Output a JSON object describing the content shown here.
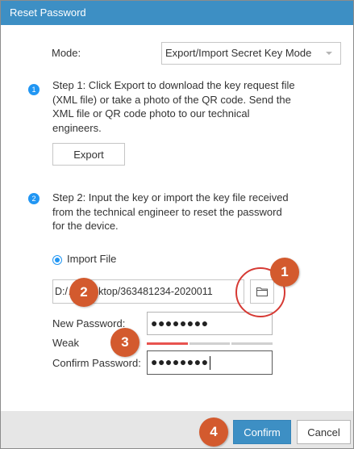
{
  "dialog": {
    "title": "Reset Password"
  },
  "mode": {
    "label": "Mode:",
    "selected": "Export/Import Secret Key Mode"
  },
  "step1": {
    "number": "1",
    "lines": [
      "Step 1: Click Export to download the key request file",
      "(XML file) or take a photo of the QR code. Send the",
      "XML file or QR code photo to our technical",
      "engineers."
    ],
    "export_label": "Export"
  },
  "step2": {
    "number": "2",
    "lines": [
      "Step 2: Input the key or import the key file received",
      "from the technical engineer to reset the password",
      "for the device."
    ],
    "import_option": "Import File",
    "file_path": "D:/…/Desktop/363481234-2020011"
  },
  "new_password": {
    "label": "New Password:",
    "masked_value": "●●●●●●●●"
  },
  "strength": {
    "label": "Weak",
    "level": 1,
    "levels_total": 3,
    "active_color": "#e8534f",
    "inactive_color": "#d0d0d0"
  },
  "confirm_password": {
    "label": "Confirm Password:",
    "masked_value": "●●●●●●●●"
  },
  "footer": {
    "confirm_label": "Confirm",
    "cancel_label": "Cancel"
  },
  "annotations": {
    "badge1": "1",
    "badge2": "2",
    "badge3": "3",
    "badge4": "4",
    "badge_color": "#d35a2e",
    "ring_color": "#d63a34"
  },
  "colors": {
    "accent": "#3d8fc4",
    "step_dot": "#2196f3"
  }
}
